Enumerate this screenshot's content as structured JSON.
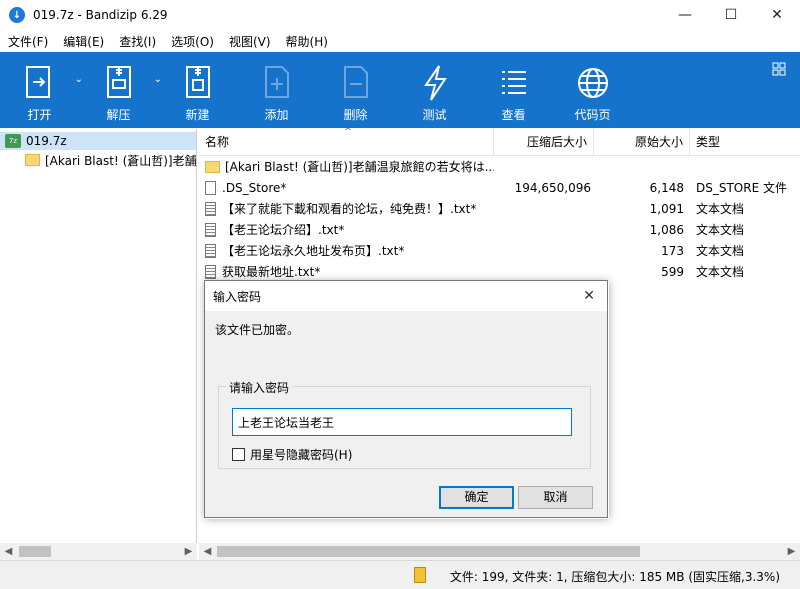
{
  "window": {
    "title": "019.7z - Bandizip 6.29",
    "controls": [
      "minimize-icon",
      "maximize-icon",
      "close-icon"
    ]
  },
  "menu": [
    "文件(F)",
    "编辑(E)",
    "查找(I)",
    "选项(O)",
    "视图(V)",
    "帮助(H)"
  ],
  "toolbar": {
    "open": "打开",
    "extract": "解压",
    "new": "新建",
    "add": "添加",
    "delete": "删除",
    "test": "测试",
    "view": "查看",
    "codepage": "代码页",
    "accent": "#1573cc"
  },
  "tree": {
    "root": "019.7z",
    "child": "[Akari Blast! (蒼山哲)]老舗"
  },
  "columns": {
    "name": "名称",
    "compressed": "压缩后大小",
    "original": "原始大小",
    "type": "类型"
  },
  "files": [
    {
      "name": "[Akari Blast! (蒼山哲)]老舗温泉旅館の若女将は...",
      "compressed": "",
      "original": "",
      "type": "",
      "icon": "folder-icon"
    },
    {
      "name": ".DS_Store*",
      "compressed": "194,650,096",
      "original": "6,148",
      "type": "DS_STORE 文件",
      "icon": "file-icon"
    },
    {
      "name": "【来了就能下載和观看的论坛，纯免费！】.txt*",
      "compressed": "",
      "original": "1,091",
      "type": "文本文档",
      "icon": "text-file-icon"
    },
    {
      "name": "【老王论坛介绍】.txt*",
      "compressed": "",
      "original": "1,086",
      "type": "文本文档",
      "icon": "text-file-icon"
    },
    {
      "name": "【老王论坛永久地址发布页】.txt*",
      "compressed": "",
      "original": "173",
      "type": "文本文档",
      "icon": "text-file-icon"
    },
    {
      "name": "获取最新地址.txt*",
      "compressed": "",
      "original": "599",
      "type": "文本文档",
      "icon": "text-file-icon"
    }
  ],
  "status": {
    "text": "文件: 199, 文件夹: 1, 压缩包大小: 185 MB (固实压缩,3.3%)"
  },
  "dialog": {
    "title": "输入密码",
    "message": "该文件已加密。",
    "group_label": "请输入密码",
    "password_value": "上老王论坛当老王",
    "checkbox_label": "用星号隐藏密码(H)",
    "checkbox_checked": false,
    "ok": "确定",
    "cancel": "取消"
  }
}
